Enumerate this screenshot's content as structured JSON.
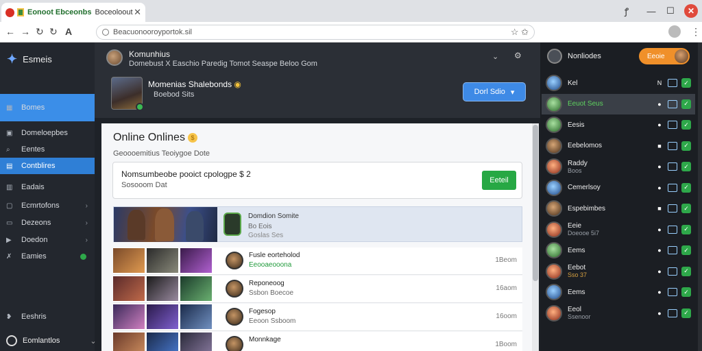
{
  "browser": {
    "tab_title": "Eonoot Ebceonbs",
    "tab_subtitle": "Boceoloout",
    "url": "Beacuonooroyportok.sil"
  },
  "sidebar": {
    "brand": "Esmeis",
    "items": [
      {
        "label": "Bomes",
        "icon": "grid-icon"
      },
      {
        "label": "Domeloepbes",
        "icon": "library-icon"
      },
      {
        "label": "Eentes",
        "icon": "search-icon"
      },
      {
        "label": "Contblires",
        "icon": "controller-icon"
      },
      {
        "label": "Eadais",
        "icon": "stats-icon"
      },
      {
        "label": "Ecmrtofons",
        "icon": "folder-icon"
      },
      {
        "label": "Dezeons",
        "icon": "screen-icon"
      },
      {
        "label": "Doedon",
        "icon": "play-icon"
      },
      {
        "label": "Eamies",
        "icon": "flag-icon"
      }
    ],
    "footer1": "Eeshris",
    "footer2": "Eomlantlos"
  },
  "header": {
    "title": "Komunhius",
    "subtitle": "Domebust X Easchio Paredig Tomot Seaspe Beloo Gom",
    "game_name": "Momenias Shalebonds",
    "game_sub": "Boebod Sits",
    "play_label": "Dorl Sdio"
  },
  "panel": {
    "title": "Online Onlines",
    "subtitle": "Geoooemitius  Teoiygoe Dote",
    "notice_title": "Nomsumbeobe pooict cpologpe $ 2",
    "notice_sub": "Sosooom  Dat",
    "notice_button": "Eeteil",
    "featured": {
      "name": "Domdion Somite",
      "sub": "Bo Eois",
      "sub2": "Goslas Ses"
    },
    "rows": [
      {
        "name": "Fusle eorteholod",
        "sub": "Eeooaeooona",
        "time": "1Beom",
        "sub_green": true
      },
      {
        "name": "Reponeoog",
        "sub": "Ssbon Boecoe",
        "time": "16aom",
        "sub_green": false
      },
      {
        "name": "Fogesop",
        "sub": "Eeoon Ssboom",
        "time": "16oom",
        "sub_green": false
      },
      {
        "name": "Monnkage",
        "sub": "",
        "time": "1Boom",
        "sub_green": false
      }
    ]
  },
  "friends": {
    "header": "Nonliodes",
    "pill": "Eeoie",
    "list": [
      {
        "name": "Kel",
        "sub": "",
        "a1": "N",
        "color": "blue"
      },
      {
        "name": "Eeuot Seus",
        "sub": "",
        "a1": "●",
        "color": "green",
        "selected": true,
        "name_green": true
      },
      {
        "name": "Eesis",
        "sub": "",
        "a1": "●",
        "color": "green"
      },
      {
        "name": "Eebelomos",
        "sub": "",
        "a1": "■",
        "color": "tan"
      },
      {
        "name": "Raddy",
        "sub": "Boos",
        "a1": "●",
        "color": "red"
      },
      {
        "name": "Cemerlsoy",
        "sub": "",
        "a1": "●",
        "color": "blue"
      },
      {
        "name": "Espebimbes",
        "sub": "",
        "a1": "■",
        "color": "tan"
      },
      {
        "name": "Eeie",
        "sub": "Doeooe 5i7",
        "a1": "●",
        "color": "red"
      },
      {
        "name": "Eems",
        "sub": "",
        "a1": "●",
        "color": "green"
      },
      {
        "name": "Eebot",
        "sub": "Sso 37",
        "a1": "●",
        "color": "red",
        "sub_amber": true
      },
      {
        "name": "Eems",
        "sub": "",
        "a1": "●",
        "color": "blue"
      },
      {
        "name": "Eeol",
        "sub": "Ssenoor",
        "a1": "●",
        "color": "red"
      }
    ]
  }
}
